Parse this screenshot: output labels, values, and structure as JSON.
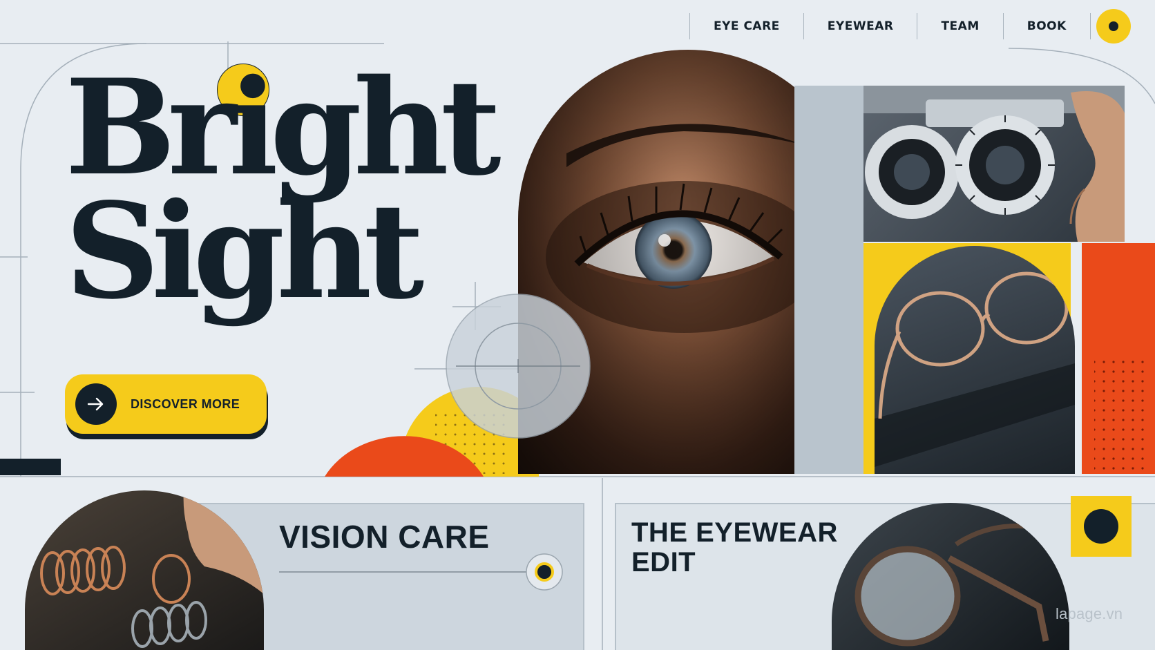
{
  "nav": {
    "items": [
      {
        "label": "EYE CARE"
      },
      {
        "label": "EYEWEAR"
      },
      {
        "label": "TEAM"
      },
      {
        "label": "BOOK"
      }
    ]
  },
  "hero": {
    "title_line1": "Bright",
    "title_line2": "Sight",
    "cta_label": "DISCOVER MORE",
    "cta_icon": "arrow-right-icon"
  },
  "cards": {
    "vision_title": "VISION CARE",
    "eyewear_title_line1": "THE EYEWEAR",
    "eyewear_title_line2": "EDIT"
  },
  "watermark": "lapage.vn",
  "colors": {
    "background": "#e8edf2",
    "ink": "#13202a",
    "yellow": "#f5cb1b",
    "orange": "#ea4a1a",
    "panel_grey": "#cdd6de"
  }
}
